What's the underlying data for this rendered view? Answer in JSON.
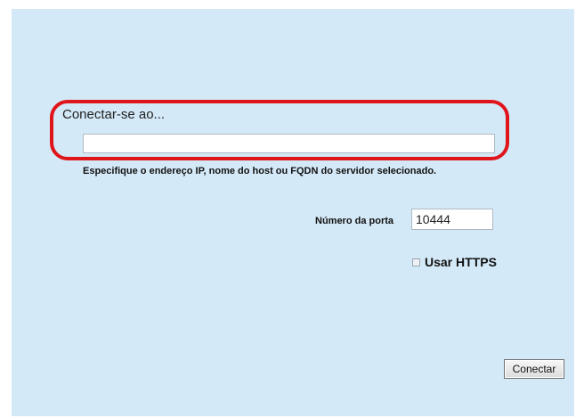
{
  "connection": {
    "title": "Conectar-se ao...",
    "server_value": "",
    "hint": "Especifique o endereço IP, nome do host ou FQDN do servidor selecionado."
  },
  "port": {
    "label": "Número da porta",
    "value": "10444"
  },
  "https": {
    "label": "Usar HTTPS",
    "checked": false
  },
  "actions": {
    "connect_label": "Conectar"
  },
  "colors": {
    "panel_background": "#d4e9f7",
    "highlight": "#e0151b"
  }
}
